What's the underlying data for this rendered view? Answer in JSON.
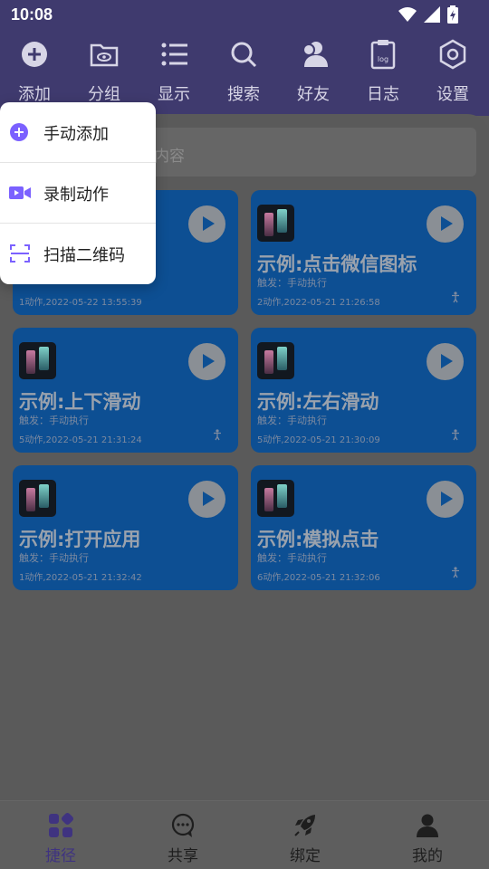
{
  "status": {
    "time": "10:08"
  },
  "toolbar": {
    "items": [
      {
        "label": "添加",
        "icon": "plus-circle-icon"
      },
      {
        "label": "分组",
        "icon": "folder-eye-icon"
      },
      {
        "label": "显示",
        "icon": "list-icon"
      },
      {
        "label": "搜索",
        "icon": "search-icon"
      },
      {
        "label": "好友",
        "icon": "friends-icon"
      },
      {
        "label": "日志",
        "icon": "log-clipboard-icon"
      },
      {
        "label": "设置",
        "icon": "hexagon-settings-icon"
      }
    ],
    "log_icon_text": "log"
  },
  "search": {
    "placeholder_visible": "内容"
  },
  "cards": [
    {
      "title": "",
      "trigger": "",
      "meta": "1动作,2022-05-22 13:55:39"
    },
    {
      "title": "示例:点击微信图标",
      "trigger": "触发：手动执行",
      "meta": "2动作,2022-05-21 21:26:58"
    },
    {
      "title": "示例:上下滑动",
      "trigger": "触发：手动执行",
      "meta": "5动作,2022-05-21 21:31:24"
    },
    {
      "title": "示例:左右滑动",
      "trigger": "触发：手动执行",
      "meta": "5动作,2022-05-21 21:30:09"
    },
    {
      "title": "示例:打开应用",
      "trigger": "触发：手动执行",
      "meta": "1动作,2022-05-21 21:32:42"
    },
    {
      "title": "示例:模拟点击",
      "trigger": "触发：手动执行",
      "meta": "6动作,2022-05-21 21:32:06"
    }
  ],
  "popup": {
    "items": [
      {
        "label": "手动添加",
        "icon": "plus-circle-icon"
      },
      {
        "label": "录制动作",
        "icon": "video-camera-icon"
      },
      {
        "label": "扫描二维码",
        "icon": "scan-qr-icon"
      }
    ]
  },
  "bottom_nav": {
    "items": [
      {
        "label": "捷径",
        "icon": "shortcuts-grid-icon",
        "active": true
      },
      {
        "label": "共享",
        "icon": "chat-bubble-icon"
      },
      {
        "label": "绑定",
        "icon": "rocket-icon"
      },
      {
        "label": "我的",
        "icon": "person-icon"
      }
    ]
  },
  "colors": {
    "header": "#3f3a6e",
    "card": "#0d4f93",
    "accent": "#7b61ff",
    "active_nav": "#3f3380"
  }
}
